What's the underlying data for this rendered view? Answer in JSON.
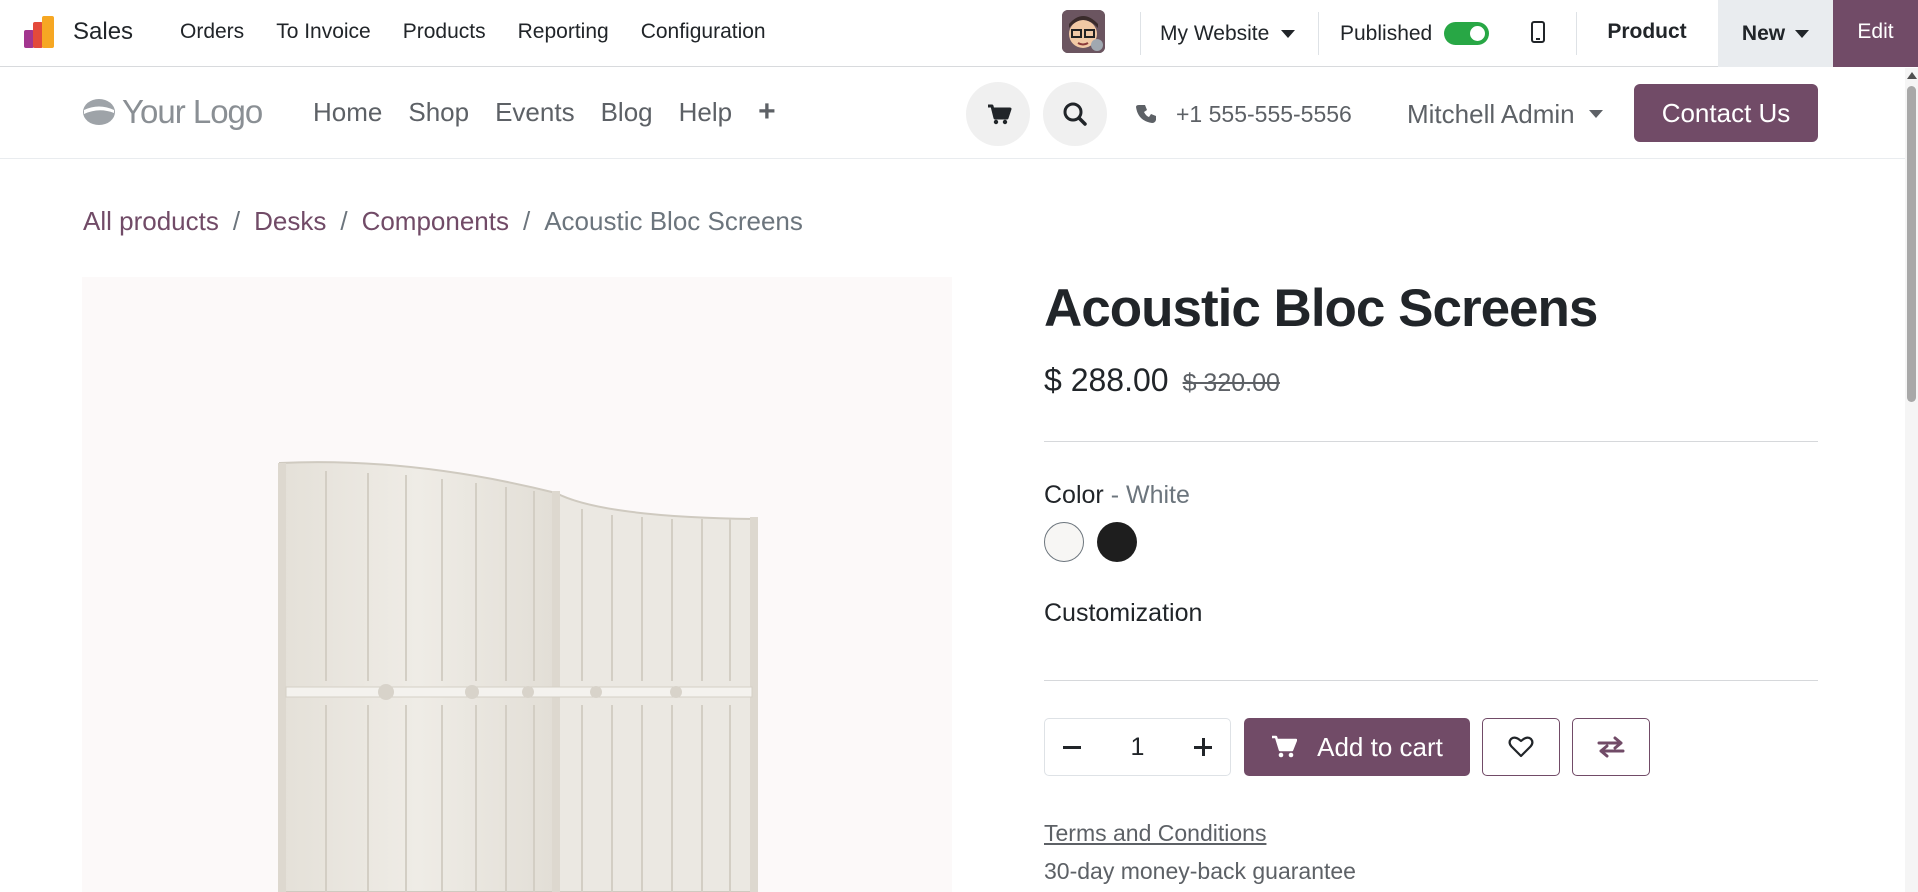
{
  "topbar": {
    "app_name": "Sales",
    "menu": [
      "Orders",
      "To Invoice",
      "Products",
      "Reporting",
      "Configuration"
    ],
    "website_label": "My Website",
    "published_label": "Published",
    "published_on": true,
    "product_label": "Product",
    "new_label": "New",
    "edit_label": "Edit"
  },
  "site_header": {
    "logo_text": "Your Logo",
    "nav": [
      "Home",
      "Shop",
      "Events",
      "Blog",
      "Help"
    ],
    "phone": "+1 555-555-5556",
    "user": "Mitchell Admin",
    "contact_label": "Contact Us"
  },
  "breadcrumb": {
    "items": [
      "All products",
      "Desks",
      "Components"
    ],
    "current": "Acoustic Bloc Screens"
  },
  "product": {
    "title": "Acoustic Bloc Screens",
    "price": "$ 288.00",
    "old_price": "$ 320.00",
    "color_label": "Color",
    "color_sep": " - ",
    "color_value": "White",
    "colors": [
      "#f7f6f4",
      "#1e1e1e"
    ],
    "customization_label": "Customization",
    "quantity": "1",
    "add_to_cart_label": "Add to cart",
    "terms_label": "Terms and Conditions",
    "guarantee": "30-day money-back guarantee"
  },
  "icons": {
    "cart": "shopping-cart-icon",
    "search": "search-icon",
    "phone": "phone-icon",
    "heart": "heart-icon",
    "compare": "compare-arrows-icon",
    "mobile": "mobile-preview-icon"
  },
  "colors": {
    "brand": "#714b67",
    "toggle_on": "#28a745"
  }
}
